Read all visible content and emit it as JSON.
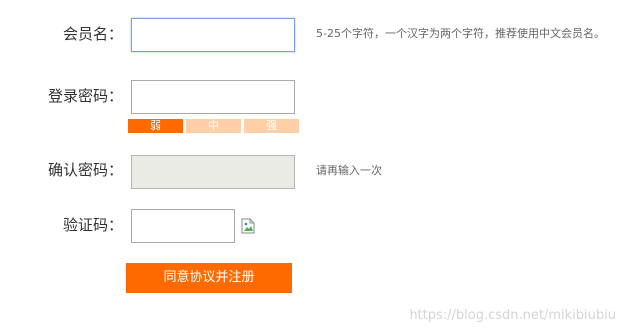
{
  "form": {
    "username": {
      "label": "会员名：",
      "value": "",
      "hint": "5-25个字符，一个汉字为两个字符，推荐使用中文会员名。"
    },
    "password": {
      "label": "登录密码：",
      "value": "",
      "strength": {
        "levels": [
          "弱",
          "中",
          "强"
        ],
        "active_level": 1
      }
    },
    "confirm_password": {
      "label": "确认密码：",
      "value": "",
      "hint": "请再输入一次"
    },
    "captcha": {
      "label": "验证码：",
      "value": "",
      "image_icon": "broken-image-icon"
    },
    "submit_label": "同意协议并注册"
  },
  "watermark": "https://blog.csdn.net/mikibiubiu",
  "colors": {
    "accent": "#ff6a00",
    "strength_inactive": "#ffd0a8",
    "focus_border": "#7a9fe0",
    "disabled_bg": "#ebebe6"
  }
}
